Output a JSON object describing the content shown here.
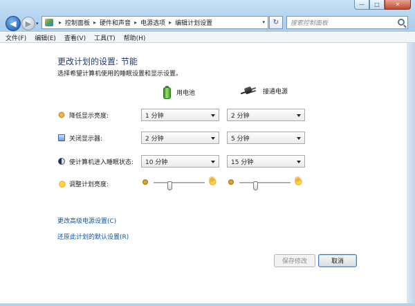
{
  "window": {
    "minimize": "—",
    "maximize": "□",
    "close": "✕"
  },
  "nav": {
    "back_icon": "◀",
    "forward_icon": "▶",
    "recent_icon": "▾"
  },
  "address": {
    "breadcrumbs": [
      "控制面板",
      "硬件和声音",
      "电源选项",
      "编辑计划设置"
    ],
    "separator": "▸",
    "dropdown_icon": "▾"
  },
  "refresh_icon": "↻",
  "search": {
    "placeholder": "搜索控制面板"
  },
  "menubar": {
    "items": [
      "文件(F)",
      "编辑(E)",
      "查看(V)",
      "工具(T)",
      "帮助(H)"
    ]
  },
  "page": {
    "title": "更改计划的设置: 节能",
    "subtitle": "选择希望计算机使用的睡眠设置和显示设置。"
  },
  "columns": {
    "battery": "用电池",
    "plugged": "接通电源"
  },
  "settings": [
    {
      "label": "降低显示亮度:",
      "battery": "1 分钟",
      "plugged": "2 分钟"
    },
    {
      "label": "关闭显示器:",
      "battery": "2 分钟",
      "plugged": "5 分钟"
    },
    {
      "label": "使计算机进入睡眠状态:",
      "battery": "10 分钟",
      "plugged": "15 分钟"
    }
  ],
  "brightness": {
    "label": "调整计划亮度:",
    "battery_level": 0.3,
    "plugged_level": 0.3
  },
  "links": {
    "advanced": "更改高级电源设置(C)",
    "restore": "还原此计划的默认设置(R)"
  },
  "buttons": {
    "save": "保存修改",
    "cancel": "取消"
  }
}
